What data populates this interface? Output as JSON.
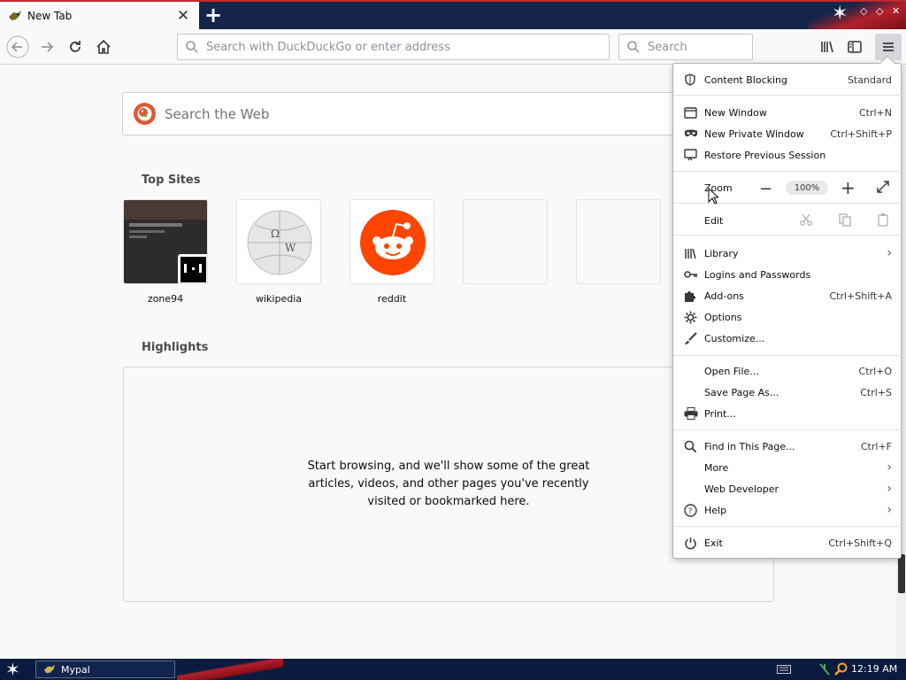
{
  "tab": {
    "title": "New Tab"
  },
  "navbar": {
    "url_placeholder": "Search with DuckDuckGo or enter address",
    "search_placeholder": "Search"
  },
  "newtab": {
    "search_placeholder": "Search the Web",
    "top_sites_title": "Top Sites",
    "top_sites": [
      {
        "label": "zone94"
      },
      {
        "label": "wikipedia"
      },
      {
        "label": "reddit"
      },
      {
        "label": ""
      },
      {
        "label": ""
      }
    ],
    "highlights_title": "Highlights",
    "highlights_empty": "Start browsing, and we'll show some of the great articles, videos, and other pages you've recently visited or bookmarked here."
  },
  "menu": {
    "content_blocking": {
      "label": "Content Blocking",
      "value": "Standard"
    },
    "new_window": {
      "label": "New Window",
      "shortcut": "Ctrl+N"
    },
    "new_private_window": {
      "label": "New Private Window",
      "shortcut": "Ctrl+Shift+P"
    },
    "restore_session": {
      "label": "Restore Previous Session"
    },
    "zoom": {
      "label": "Zoom",
      "value": "100%"
    },
    "edit": {
      "label": "Edit"
    },
    "library": {
      "label": "Library"
    },
    "logins": {
      "label": "Logins and Passwords"
    },
    "addons": {
      "label": "Add-ons",
      "shortcut": "Ctrl+Shift+A"
    },
    "options": {
      "label": "Options"
    },
    "customize": {
      "label": "Customize..."
    },
    "open_file": {
      "label": "Open File...",
      "shortcut": "Ctrl+O"
    },
    "save_page": {
      "label": "Save Page As...",
      "shortcut": "Ctrl+S"
    },
    "print": {
      "label": "Print..."
    },
    "find": {
      "label": "Find in This Page...",
      "shortcut": "Ctrl+F"
    },
    "more": {
      "label": "More"
    },
    "web_developer": {
      "label": "Web Developer"
    },
    "help": {
      "label": "Help"
    },
    "exit": {
      "label": "Exit",
      "shortcut": "Ctrl+Shift+Q"
    }
  },
  "taskbar": {
    "app_label": "Mypal",
    "clock": "12:19 AM"
  },
  "colors": {
    "accent_orange": "#de5833",
    "reddit": "#ff4500",
    "titlebar": "#15254a"
  }
}
